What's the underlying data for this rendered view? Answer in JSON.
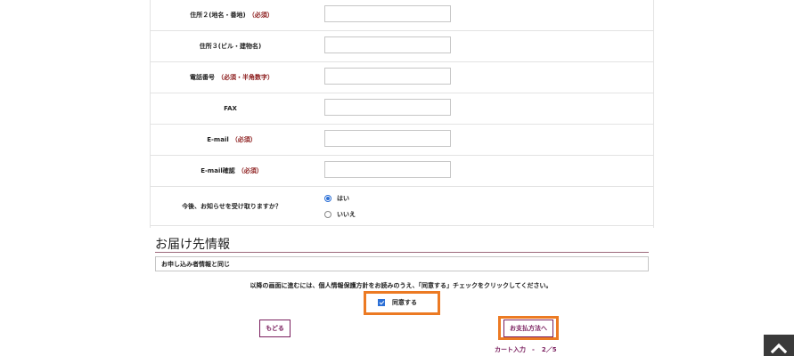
{
  "form": {
    "rows": [
      {
        "label": "住所２(地名・番地)",
        "required": "（必須）"
      },
      {
        "label": "住所３(ビル・建物名)",
        "required": ""
      },
      {
        "label": "電話番号",
        "required": "（必須・半角数字）"
      },
      {
        "label": "FAX",
        "required": ""
      },
      {
        "label": "E-mail",
        "required": "（必須）"
      },
      {
        "label": "E-mail確認",
        "required": "（必須）"
      }
    ],
    "newsletter": {
      "label": "今後、お知らせを受け取りますか？",
      "options": [
        "はい",
        "いいえ"
      ],
      "selected": "はい"
    }
  },
  "delivery": {
    "title": "お届け先情報",
    "value": "お申し込み者情報と同じ"
  },
  "privacy": {
    "notice": "以降の画面に進むには、個人情報保護方針をお読みのうえ、「同意する」チェックをクリックしてください。",
    "agree_label": "同意する",
    "checked": true
  },
  "buttons": {
    "back": "もどる",
    "next": "お支払方法へ"
  },
  "step": {
    "label": "カート入力　-",
    "progress": "2／5"
  },
  "colors": {
    "accent": "#7a1f5e",
    "required": "#8b1a1a",
    "highlight": "#ec7a23",
    "checkbox": "#2b6fd6"
  },
  "icons": {
    "scroll_top": "chevron-up-icon"
  }
}
